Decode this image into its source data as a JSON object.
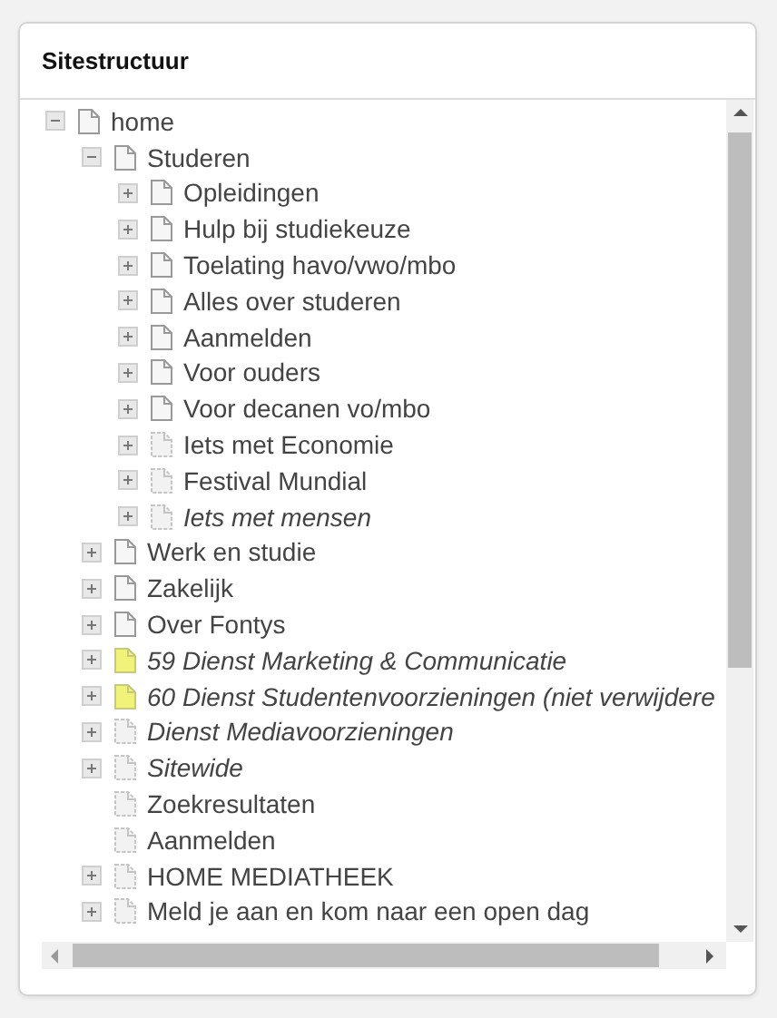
{
  "panel": {
    "title": "Sitestructuur"
  },
  "tree": [
    {
      "label": "home",
      "kind": "page",
      "italic": false,
      "expanded": true,
      "children": [
        {
          "label": "Studeren",
          "kind": "page",
          "italic": false,
          "expanded": true,
          "children": [
            {
              "label": "Opleidingen",
              "kind": "page",
              "italic": false,
              "expanded": false
            },
            {
              "label": "Hulp bij studiekeuze",
              "kind": "page",
              "italic": false,
              "expanded": false
            },
            {
              "label": "Toelating havo/vwo/mbo",
              "kind": "page",
              "italic": false,
              "expanded": false
            },
            {
              "label": "Alles over studeren",
              "kind": "page",
              "italic": false,
              "expanded": false
            },
            {
              "label": "Aanmelden",
              "kind": "page",
              "italic": false,
              "expanded": false
            },
            {
              "label": "Voor ouders",
              "kind": "page",
              "italic": false,
              "expanded": false
            },
            {
              "label": "Voor decanen vo/mbo",
              "kind": "page",
              "italic": false,
              "expanded": false
            },
            {
              "label": "Iets met Economie",
              "kind": "hidden",
              "italic": false,
              "expanded": false
            },
            {
              "label": "Festival Mundial",
              "kind": "hidden",
              "italic": false,
              "expanded": false
            },
            {
              "label": "Iets met mensen",
              "kind": "hidden",
              "italic": true,
              "expanded": false
            }
          ]
        },
        {
          "label": "Werk en studie",
          "kind": "page",
          "italic": false,
          "expanded": false
        },
        {
          "label": "Zakelijk",
          "kind": "page",
          "italic": false,
          "expanded": false
        },
        {
          "label": "Over Fontys",
          "kind": "page",
          "italic": false,
          "expanded": false
        },
        {
          "label": "59 Dienst Marketing & Communicatie",
          "kind": "marked",
          "italic": true,
          "expanded": false
        },
        {
          "label": "60 Dienst Studentenvoorzieningen (niet verwijdere",
          "kind": "marked",
          "italic": true,
          "expanded": false
        },
        {
          "label": "Dienst Mediavoorzieningen",
          "kind": "hidden",
          "italic": true,
          "expanded": false
        },
        {
          "label": "Sitewide",
          "kind": "hidden",
          "italic": true,
          "expanded": false
        },
        {
          "label": "Zoekresultaten",
          "kind": "hidden",
          "italic": false
        },
        {
          "label": "Aanmelden",
          "kind": "hidden",
          "italic": false
        },
        {
          "label": "HOME MEDIATHEEK",
          "kind": "hidden",
          "italic": false,
          "expanded": false
        },
        {
          "label": "Meld je aan en kom naar een open dag",
          "kind": "hidden",
          "italic": false,
          "expanded": false
        }
      ]
    }
  ]
}
